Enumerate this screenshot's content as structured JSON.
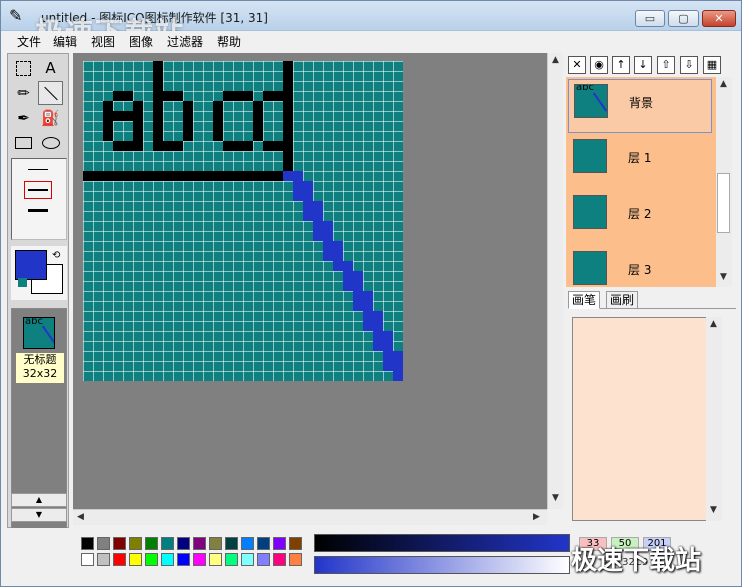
{
  "window": {
    "title": "untitled - 图标ICO图标制作软件 [31, 31]",
    "watermark": "极速下载站",
    "min_label": "▭",
    "max_label": "▢",
    "close_label": "✕"
  },
  "menu": [
    "文件",
    "编辑",
    "视图",
    "图像",
    "过滤器",
    "帮助"
  ],
  "tools": {
    "text_tool": "A"
  },
  "document": {
    "name": "无标题",
    "size": "32x32",
    "thumb_text": "abc"
  },
  "layers": [
    {
      "name": "背景",
      "thumb_text": "abc"
    },
    {
      "name": "层 1"
    },
    {
      "name": "层 2"
    },
    {
      "name": "层 3"
    }
  ],
  "tabs": {
    "brush": "画笔",
    "paint": "画刷"
  },
  "color_values": {
    "r": "33",
    "g": "50",
    "b": "201",
    "hex": "#2132C9"
  },
  "colors": {
    "teal": "#0f8080",
    "blue": "#2235c9",
    "layer_bg": "#fcbf8c"
  },
  "palette": [
    "#000000",
    "#808080",
    "#800000",
    "#808000",
    "#008000",
    "#008080",
    "#000080",
    "#800080",
    "#808040",
    "#004040",
    "#0080ff",
    "#004080",
    "#8000ff",
    "#804000",
    "#ffffff",
    "#c0c0c0",
    "#ff0000",
    "#ffff00",
    "#00ff00",
    "#00ffff",
    "#0000ff",
    "#ff00ff",
    "#ffff80",
    "#00ff80",
    "#80ffff",
    "#8080ff",
    "#ff0080",
    "#ff8040"
  ]
}
